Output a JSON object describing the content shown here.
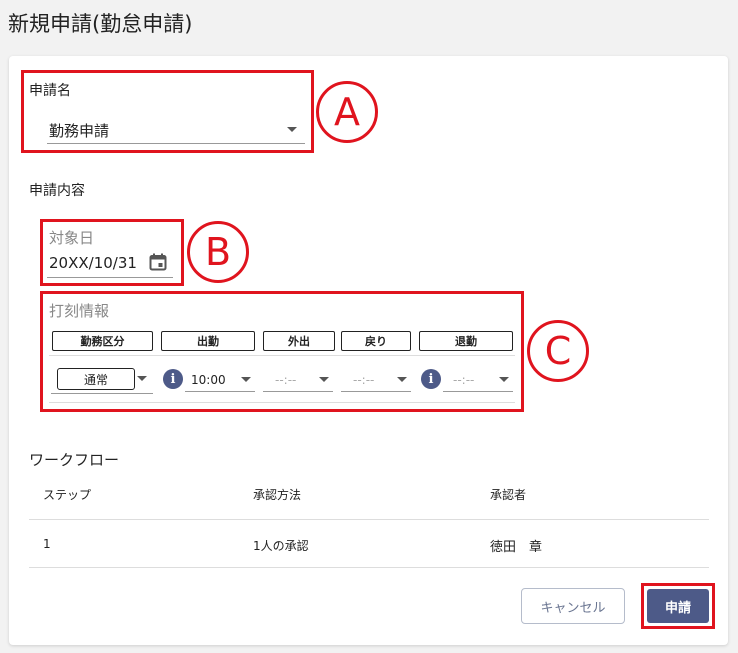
{
  "page": {
    "title": "新規申請(勤怠申請)"
  },
  "application_name": {
    "label": "申請名",
    "value": "勤務申請"
  },
  "content": {
    "label": "申請内容"
  },
  "target_date": {
    "label": "対象日",
    "value": "20XX/10/31"
  },
  "stamp_info": {
    "label": "打刻情報",
    "headers": [
      "勤務区分",
      "出勤",
      "外出",
      "戻り",
      "退勤"
    ],
    "work_type": "通常",
    "times": [
      "10:00",
      "--:--",
      "--:--",
      "--:--"
    ]
  },
  "workflow": {
    "title": "ワークフロー",
    "columns": [
      "ステップ",
      "承認方法",
      "承認者"
    ],
    "rows": [
      {
        "step": "1",
        "method": "1人の承認",
        "approver": "徳田　章"
      }
    ]
  },
  "annotations": {
    "a": "A",
    "b": "B",
    "c": "C",
    "color": "#e0141e"
  },
  "buttons": {
    "cancel": "キャンセル",
    "submit": "申請"
  },
  "colors": {
    "accent": "#4d5a88"
  }
}
